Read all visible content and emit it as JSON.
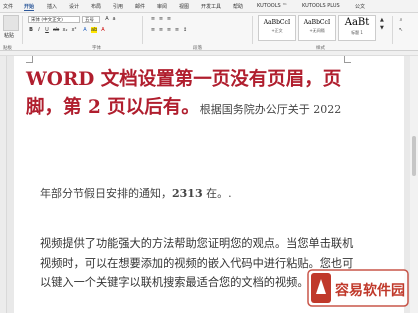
{
  "tabs": [
    "文件",
    "开始",
    "插入",
    "设计",
    "布局",
    "引用",
    "邮件",
    "审阅",
    "视图",
    "开发工具",
    "帮助",
    "KUTOOLS ™",
    "KUTOOLS PLUS",
    "公文"
  ],
  "active_tab": "开始",
  "ribbon": {
    "paste_label": "粘贴",
    "clipboard_label": "贴板",
    "font_name": "宋体 (中文正文)",
    "font_size": "五号",
    "font_group_label": "字体",
    "paragraph_group_label": "段落",
    "styles_group_label": "样式",
    "styles": [
      {
        "sample": "AaBbCcI",
        "name": "+正文"
      },
      {
        "sample": "AaBbCcI",
        "name": "+无间隔"
      },
      {
        "sample": "AaBt",
        "name": "标题 1"
      }
    ]
  },
  "document": {
    "heading_line1": "WORD 文档设置第一页没有页眉，页",
    "heading_line2_a": "脚，第 2 页以后有。",
    "heading_line2_note": "根据国务院办公厅关于 2022",
    "note_line": "年部分节假日安排的通知，",
    "note_number": "2313",
    "note_end": " 在。.",
    "paragraph": "视频提供了功能强大的方法帮助您证明您的观点。当您单击联机视频时，可以在想要添加的视频的嵌入代码中进行粘贴。您也可以键入一个关键字以联机搜索最适合您的文档的视频。"
  },
  "watermark": {
    "text": "容易软件园",
    "color": "#c0392b"
  }
}
